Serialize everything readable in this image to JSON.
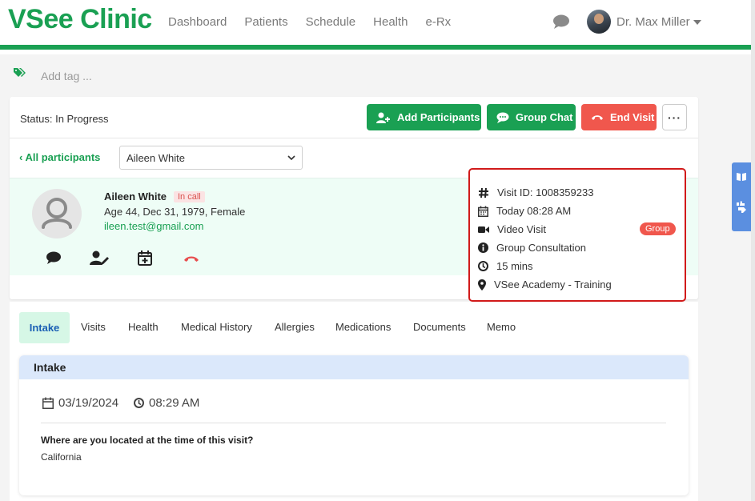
{
  "header": {
    "brand": "VSee Clinic",
    "nav": [
      "Dashboard",
      "Patients",
      "Schedule",
      "Health",
      "e-Rx"
    ],
    "user_name": "Dr. Max Miller"
  },
  "tags": {
    "placeholder": "Add tag ..."
  },
  "visit": {
    "status": "Status: In Progress",
    "buttons": {
      "add_participants": "Add Participants",
      "group_chat": "Group Chat",
      "end_visit": "End Visit",
      "more": "···"
    },
    "all_participants": "All participants",
    "selected_participant": "Aileen White"
  },
  "participant": {
    "name": "Aileen White",
    "badge": "In call",
    "meta": "Age 44, Dec 31, 1979, Female",
    "email": "ileen.test@gmail.com"
  },
  "details": {
    "visit_id": "Visit ID: 1008359233",
    "time": "Today 08:28 AM",
    "type": "Video Visit",
    "type_badge": "Group",
    "reason": "Group Consultation",
    "duration": "15 mins",
    "location": "VSee Academy - Training"
  },
  "tabs": {
    "active": "Intake",
    "items": [
      "Visits",
      "Health",
      "Medical History",
      "Allergies",
      "Medications",
      "Documents",
      "Memo"
    ]
  },
  "intake": {
    "title": "Intake",
    "date": "03/19/2024",
    "time": "08:29 AM",
    "question": "Where are you located at the time of this visit?",
    "answer": "California"
  },
  "colors": {
    "brand": "#1aa053",
    "danger": "#f0574d",
    "highlight_border": "#d11a1a"
  }
}
